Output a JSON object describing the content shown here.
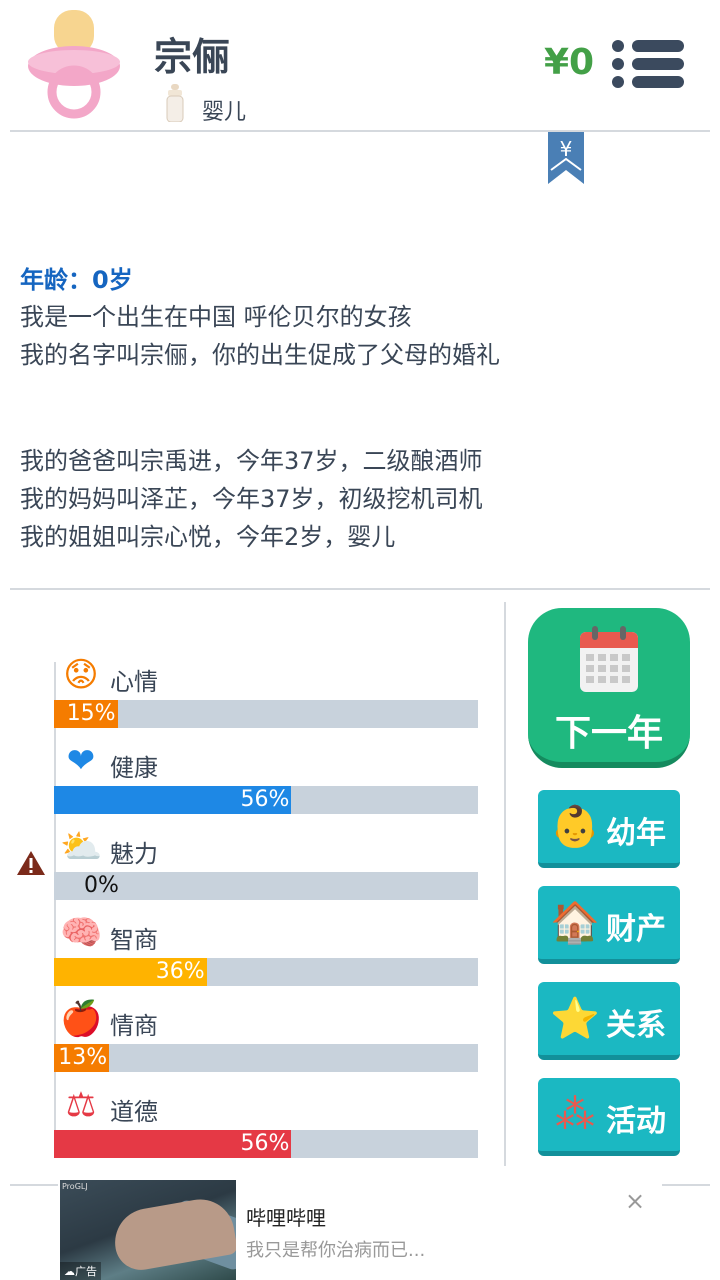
{
  "header": {
    "name": "宗俪",
    "stage": "婴儿",
    "money": "¥0",
    "avatar_icon": "pacifier-icon",
    "stage_icon": "baby-bottle-icon",
    "menu_icon": "list-menu-icon"
  },
  "bookmark_symbol": "¥",
  "story": {
    "age_line": "年龄：0岁",
    "para1": [
      "我是一个出生在中国 呼伦贝尔的女孩",
      "我的名字叫宗俪，你的出生促成了父母的婚礼"
    ],
    "para2": [
      "我的爸爸叫宗禹进，今年37岁，二级酿酒师",
      "我的妈妈叫泽芷，今年37岁，初级挖机司机",
      "我的姐姐叫宗心悦，今年2岁，婴儿"
    ]
  },
  "stats": [
    {
      "label": "心情",
      "value": 15,
      "pct_text": "15%",
      "color": "#f57c00",
      "icon": "worried-face-icon",
      "glyph": "😟"
    },
    {
      "label": "健康",
      "value": 56,
      "pct_text": "56%",
      "color": "#1e88e5",
      "icon": "heart-icon",
      "glyph": "❤"
    },
    {
      "label": "魅力",
      "value": 0,
      "pct_text": "0%",
      "color": "#ffb300",
      "icon": "sun-cloud-icon",
      "glyph": "⛅"
    },
    {
      "label": "智商",
      "value": 36,
      "pct_text": "36%",
      "color": "#ffb300",
      "icon": "brain-icon",
      "glyph": "🧠"
    },
    {
      "label": "情商",
      "value": 13,
      "pct_text": "13%",
      "color": "#f57c00",
      "icon": "apple-icon",
      "glyph": "🍎"
    },
    {
      "label": "道德",
      "value": 56,
      "pct_text": "56%",
      "color": "#e53945",
      "icon": "scales-icon",
      "glyph": "⚖"
    }
  ],
  "warning_icon": "warning-icon",
  "actions": {
    "next_year": "下一年",
    "next_icon": "calendar-icon",
    "buttons": [
      {
        "label": "幼年",
        "icon": "baby-face-icon",
        "glyph": "👶"
      },
      {
        "label": "财产",
        "icon": "house-icon",
        "glyph": "🏠"
      },
      {
        "label": "关系",
        "icon": "star-icon",
        "glyph": "⭐"
      },
      {
        "label": "活动",
        "icon": "molecule-icon",
        "glyph": "⁂"
      }
    ]
  },
  "ad": {
    "title": "哔哩哔哩",
    "desc": "我只是帮你治病而已...",
    "tag": "广告",
    "close": "×",
    "source": "ProGLJ"
  }
}
